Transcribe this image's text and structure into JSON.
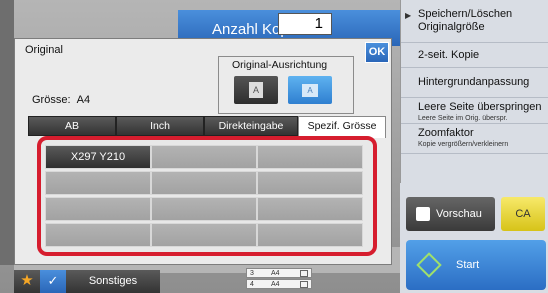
{
  "copies": {
    "label": "Anzahl Kopien",
    "value": "1"
  },
  "right_panel": {
    "items": [
      {
        "title": "Speichern/Löschen Originalgröße",
        "sub": ""
      },
      {
        "title": "2-seit. Kopie",
        "sub": ""
      },
      {
        "title": "Hintergrundanpassung",
        "sub": ""
      },
      {
        "title": "Leere Seite überspringen",
        "sub": "Leere Seite im Orig. überspr."
      },
      {
        "title": "Zoomfaktor",
        "sub": "Kopie vergrößern/verkleinern"
      }
    ],
    "preview_label": "Vorschau",
    "ca_label": "CA",
    "start_label": "Start"
  },
  "dialog": {
    "title": "Original",
    "ok_label": "OK",
    "size_label": "Grösse:",
    "size_value": "A4",
    "orientation_label": "Original-Ausrichtung",
    "orientation_icon_1": "A",
    "orientation_icon_2": "A",
    "tabs": [
      "AB",
      "Inch",
      "Direkteingabe",
      "Spezif. Grösse"
    ],
    "active_tab": "Spezif. Grösse",
    "selected_cell": "X297 Y210"
  },
  "bottom": {
    "sonstiges_label": "Sonstiges",
    "trays": [
      {
        "num": "3",
        "paper": "A4"
      },
      {
        "num": "4",
        "paper": "A4"
      }
    ]
  },
  "colors": {
    "accent_blue": "#2a66b8",
    "highlight_red": "#d61d2e",
    "ca_yellow": "#e8d431"
  }
}
